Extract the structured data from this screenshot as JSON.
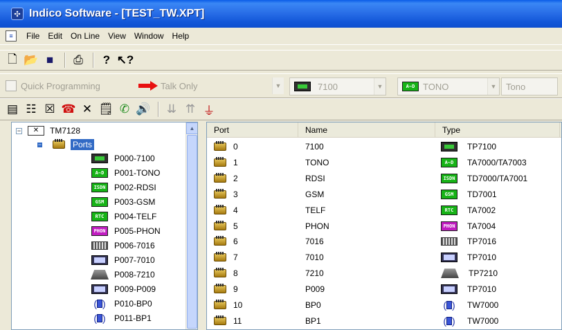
{
  "window": {
    "title": "Indico Software - [TEST_TW.XPT]"
  },
  "menu": [
    "File",
    "Edit",
    "On Line",
    "View",
    "Window",
    "Help"
  ],
  "toolbar1": {
    "icons": [
      "new-file-icon",
      "open-folder-icon",
      "save-icon",
      "print-icon",
      "help-icon",
      "context-help-icon"
    ]
  },
  "quick": {
    "quick_programming_label": "Quick Programming",
    "talk_only_label": "Talk Only",
    "model_value": "7100",
    "type_value": "TONO",
    "tone_value": "Tono"
  },
  "tree": {
    "root": "TM7128",
    "ports_label": "Ports",
    "items": [
      {
        "label": "P000-7100",
        "icon": "phone"
      },
      {
        "label": "P001-TONO",
        "icon": "analog"
      },
      {
        "label": "P002-RDSI",
        "icon": "isdn"
      },
      {
        "label": "P003-GSM",
        "icon": "gsm"
      },
      {
        "label": "P004-TELF",
        "icon": "rtc"
      },
      {
        "label": "P005-PHON",
        "icon": "phon"
      },
      {
        "label": "P006-7016",
        "icon": "keyboard"
      },
      {
        "label": "P007-7010",
        "icon": "console"
      },
      {
        "label": "P008-7210",
        "icon": "pad"
      },
      {
        "label": "P009-P009",
        "icon": "console"
      },
      {
        "label": "P010-BP0",
        "icon": "bp"
      },
      {
        "label": "P011-BP1",
        "icon": "bp"
      }
    ]
  },
  "grid": {
    "headers": [
      "Port",
      "Name",
      "Type"
    ],
    "rows": [
      {
        "port": "0",
        "name": "7100",
        "type": "TP7100",
        "icon": "phone"
      },
      {
        "port": "1",
        "name": "TONO",
        "type": "TA7000/TA7003",
        "icon": "analog"
      },
      {
        "port": "2",
        "name": "RDSI",
        "type": "TD7000/TA7001",
        "icon": "isdn"
      },
      {
        "port": "3",
        "name": "GSM",
        "type": "TD7001",
        "icon": "gsm"
      },
      {
        "port": "4",
        "name": "TELF",
        "type": "TA7002",
        "icon": "rtc"
      },
      {
        "port": "5",
        "name": "PHON",
        "type": "TA7004",
        "icon": "phon"
      },
      {
        "port": "6",
        "name": "7016",
        "type": "TP7016",
        "icon": "keyboard"
      },
      {
        "port": "7",
        "name": "7010",
        "type": "TP7010",
        "icon": "console"
      },
      {
        "port": "8",
        "name": "7210",
        "type": "TP7210",
        "icon": "pad"
      },
      {
        "port": "9",
        "name": "P009",
        "type": "TP7010",
        "icon": "console"
      },
      {
        "port": "10",
        "name": "BP0",
        "type": "TW7000",
        "icon": "bp"
      },
      {
        "port": "11",
        "name": "BP1",
        "type": "TW7000",
        "icon": "bp"
      }
    ]
  },
  "badges": {
    "analog": "A~D",
    "isdn": "ISDN",
    "gsm": "GSM",
    "rtc": "RTC",
    "phon": "PHON"
  },
  "colors": {
    "title_bar": "#2a6fe8",
    "selection": "#316ac5",
    "green_badge": "#17b317",
    "pink_badge": "#c01cc0"
  }
}
